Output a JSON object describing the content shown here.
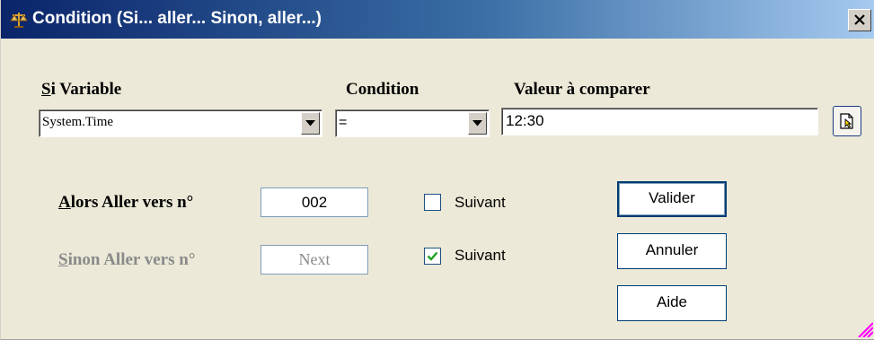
{
  "window": {
    "title": "Condition (Si... aller... Sinon, aller...)",
    "icons": {
      "title": "scales-icon",
      "close": "close-icon",
      "browse": "browse-icon",
      "resize": "resize-grip-icon"
    }
  },
  "variable": {
    "label_accel": "S",
    "label_rest": "i Variable",
    "value": "System.Time"
  },
  "condition": {
    "label": "Condition",
    "value": "="
  },
  "compare": {
    "label": "Valeur à comparer",
    "value": "12:30"
  },
  "then_goto": {
    "label_accel": "A",
    "label_rest": "lors Aller vers n°",
    "value": "002",
    "next_checked": false,
    "next_label": "Suivant"
  },
  "else_goto": {
    "label_accel": "S",
    "label_rest": "inon Aller vers n°",
    "value": "Next",
    "next_checked": true,
    "next_label": "Suivant",
    "disabled": true
  },
  "buttons": {
    "validate": "Valider",
    "cancel": "Annuler",
    "help": "Aide"
  },
  "colors": {
    "title_start": "#0a246a",
    "title_end": "#a6caf0",
    "dialog_bg": "#ECE9D8",
    "check_mark": "#21a121",
    "disabled_text": "#8a8a8a"
  }
}
